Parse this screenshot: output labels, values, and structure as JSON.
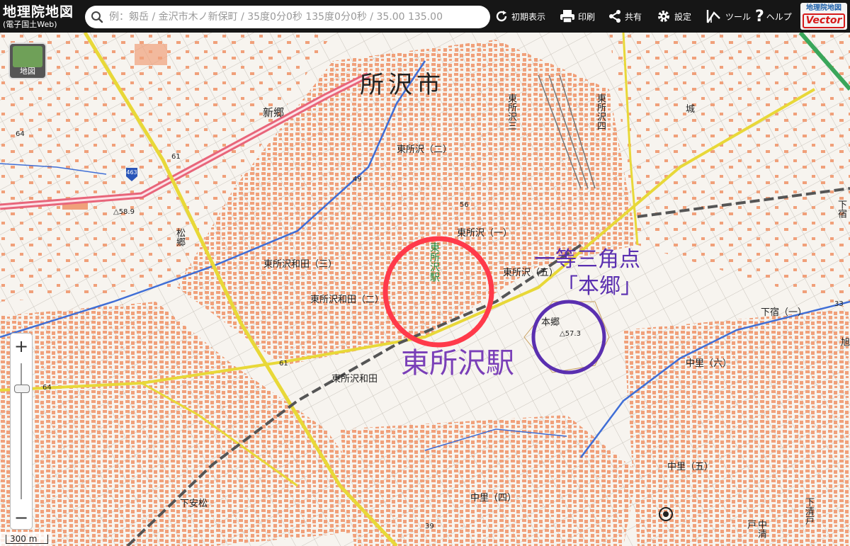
{
  "app": {
    "title": "地理院地図",
    "subtitle": "(電子国土Web)"
  },
  "search": {
    "placeholder": "例：剱岳 / 金沢市木ノ新保町 / 35度0分0秒 135度0分0秒 / 35.00 135.00"
  },
  "toolbar": {
    "initial_view": "初期表示",
    "print": "印刷",
    "share": "共有",
    "settings": "設定",
    "tools": "ツール",
    "help": "ヘルプ",
    "vector_top": "地理院地図",
    "vector_bottom": "Vector"
  },
  "colors": {
    "toolbar_bg": "#161616",
    "building": "#f0a07a",
    "road_yellow": "#e8d838",
    "expressway": "#e8657a",
    "river": "#3f6ed6",
    "annotation_red": "#ff3a4a",
    "annotation_purple": "#7a3fb8",
    "annotation_violet": "#5a2fb0"
  },
  "map": {
    "layer_button_label": "地図",
    "scale_label": "300 m",
    "zoom_in": "+",
    "zoom_out": "−",
    "city_label": "所沢市",
    "labels": {
      "shingo": "新郷",
      "higashi_tokorozawa_2": "東所沢（二）",
      "higashi_tokorozawa_1": "東所沢（一）",
      "higashi_tokorozawa_5": "東所沢（五）",
      "higashi_tokorozawa_wada_3": "東所沢和田（三）",
      "higashi_tokorozawa_wada_2": "東所沢和田（二）",
      "higashi_tokorozawa_wada": "東所沢和田",
      "matsugo": "松郷",
      "shimoyasumatsu": "下安松",
      "nakazato_4": "中里（四）",
      "nakazato_5": "中里（五）",
      "nakazato_6": "中里（六）",
      "shimojuku_1": "下宿（一）",
      "hongo_small": "本郷",
      "jo": "城",
      "higashi_tokorozawa_3_v": "東所沢三",
      "higashi_tokorozawa_4_v": "東所沢四",
      "station_small": "東所沢駅",
      "shimo_right": "下宿",
      "shimokiyoto": "下清戸",
      "nakakiyoto": "中清戸",
      "kita": "旭"
    },
    "elevations": {
      "e64a": "64",
      "e61a": "61",
      "e49": "49",
      "e56": "56",
      "e58": "△58.9",
      "e57": "△57.3",
      "e61b": "61",
      "e64b": "64",
      "e39": "39",
      "e33": "33"
    },
    "route_shield": "463",
    "annotations": {
      "station_annotation": "東所沢駅",
      "triangulation_line1": "一等三角点",
      "triangulation_line2": "「本郷」"
    }
  }
}
